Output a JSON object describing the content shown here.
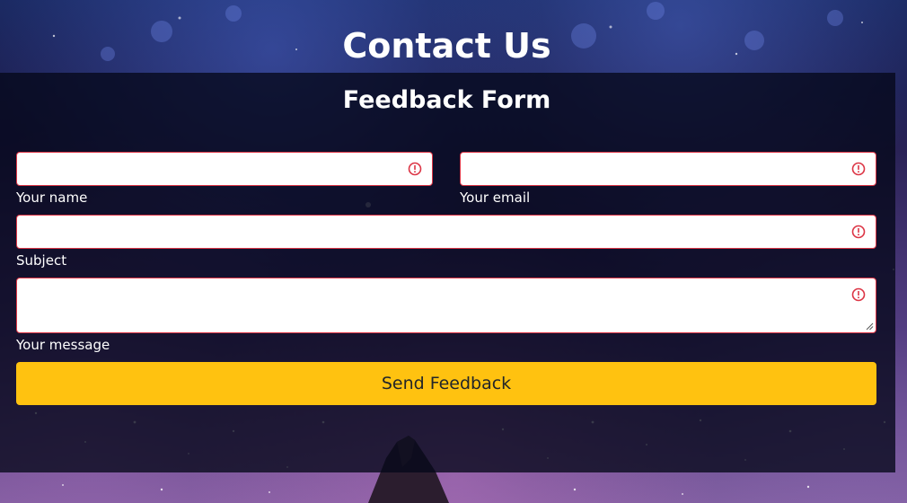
{
  "header": {
    "title": "Contact Us"
  },
  "form": {
    "title": "Feedback Form",
    "fields": {
      "name": {
        "label": "Your name",
        "value": "",
        "status": "invalid"
      },
      "email": {
        "label": "Your email",
        "value": "",
        "status": "invalid"
      },
      "subject": {
        "label": "Subject",
        "value": "",
        "status": "invalid"
      },
      "message": {
        "label": "Your message",
        "value": "",
        "status": "invalid"
      }
    },
    "submit_label": "Send Feedback"
  },
  "icons": {
    "field_status": "exclamation-circle-icon"
  },
  "colors": {
    "accent": "#ffc210",
    "invalid": "#dc3545",
    "panel": "#050819",
    "text": "#ffffff"
  }
}
